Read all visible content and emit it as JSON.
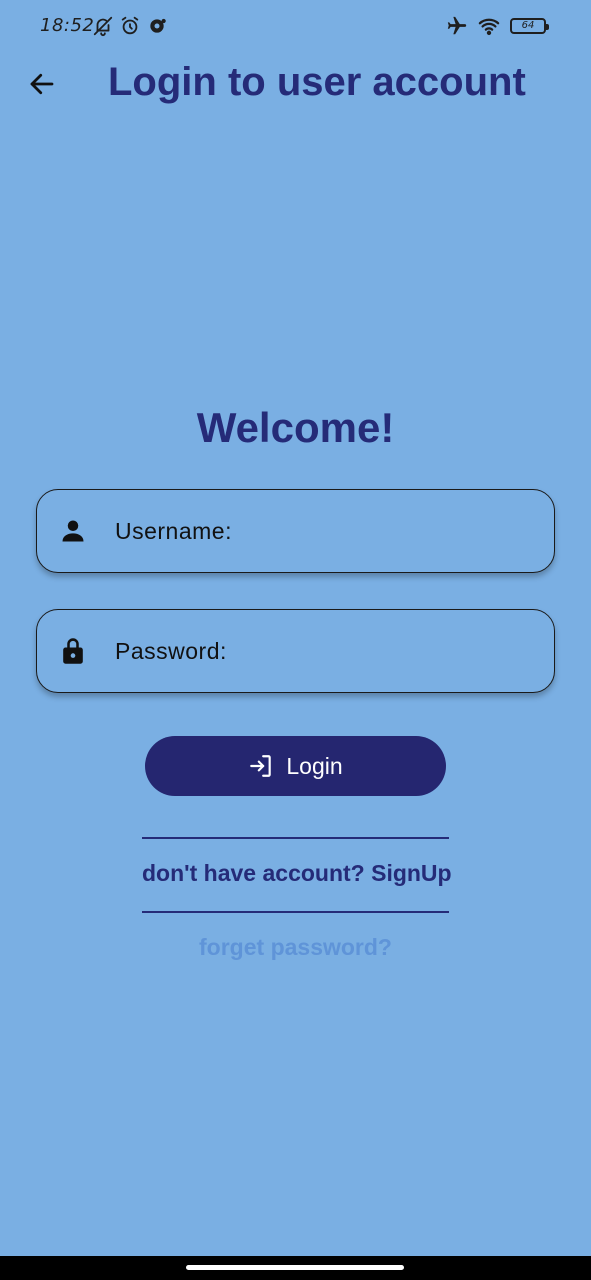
{
  "status_bar": {
    "time": "18:52",
    "battery_level": "64",
    "icons": [
      "bell-off-icon",
      "alarm-icon",
      "cast-icon",
      "airplane-icon",
      "wifi-icon",
      "battery-icon"
    ]
  },
  "app_bar": {
    "back_icon": "arrow-left-icon",
    "title": "Login to user account"
  },
  "main": {
    "welcome": "Welcome!",
    "username": {
      "icon": "person-icon",
      "placeholder": "Username:",
      "value": ""
    },
    "password": {
      "icon": "lock-icon",
      "placeholder": "Password:",
      "value": ""
    },
    "login_button": {
      "icon": "login-icon",
      "label": "Login"
    },
    "signup_link": "don't have account? SignUp",
    "forget_link": "forget password?"
  },
  "colors": {
    "background": "#7aafe3",
    "primary": "#252b78",
    "button": "#252670",
    "link_muted": "#5f94d8"
  }
}
